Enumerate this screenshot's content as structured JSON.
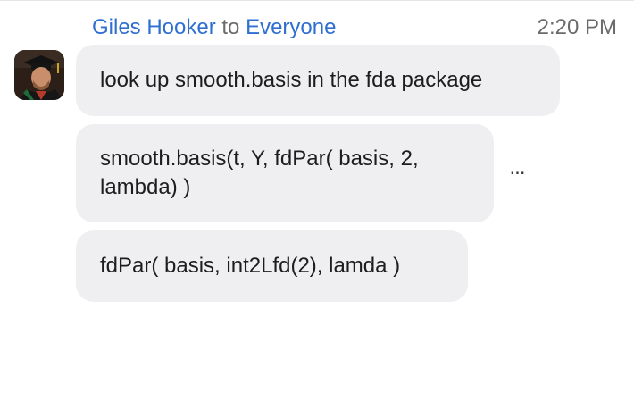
{
  "message": {
    "sender": "Giles Hooker",
    "to_word": "to",
    "recipient": "Everyone",
    "timestamp": "2:20 PM",
    "avatar_icon": "user-avatar-graduation-photo"
  },
  "bubbles": [
    {
      "text": "look up smooth.basis in the fda package"
    },
    {
      "text": "smooth.basis(t, Y, fdPar( basis, 2, lambda) )"
    },
    {
      "text": "fdPar( basis, int2Lfd(2), lamda )"
    }
  ],
  "more_button": {
    "label": "...",
    "icon": "more-options-icon"
  },
  "colors": {
    "name_link": "#2f6fd0",
    "meta_text": "#6b6b6b",
    "bubble_bg": "#efeff2",
    "bubble_text": "#1d1d1d"
  }
}
